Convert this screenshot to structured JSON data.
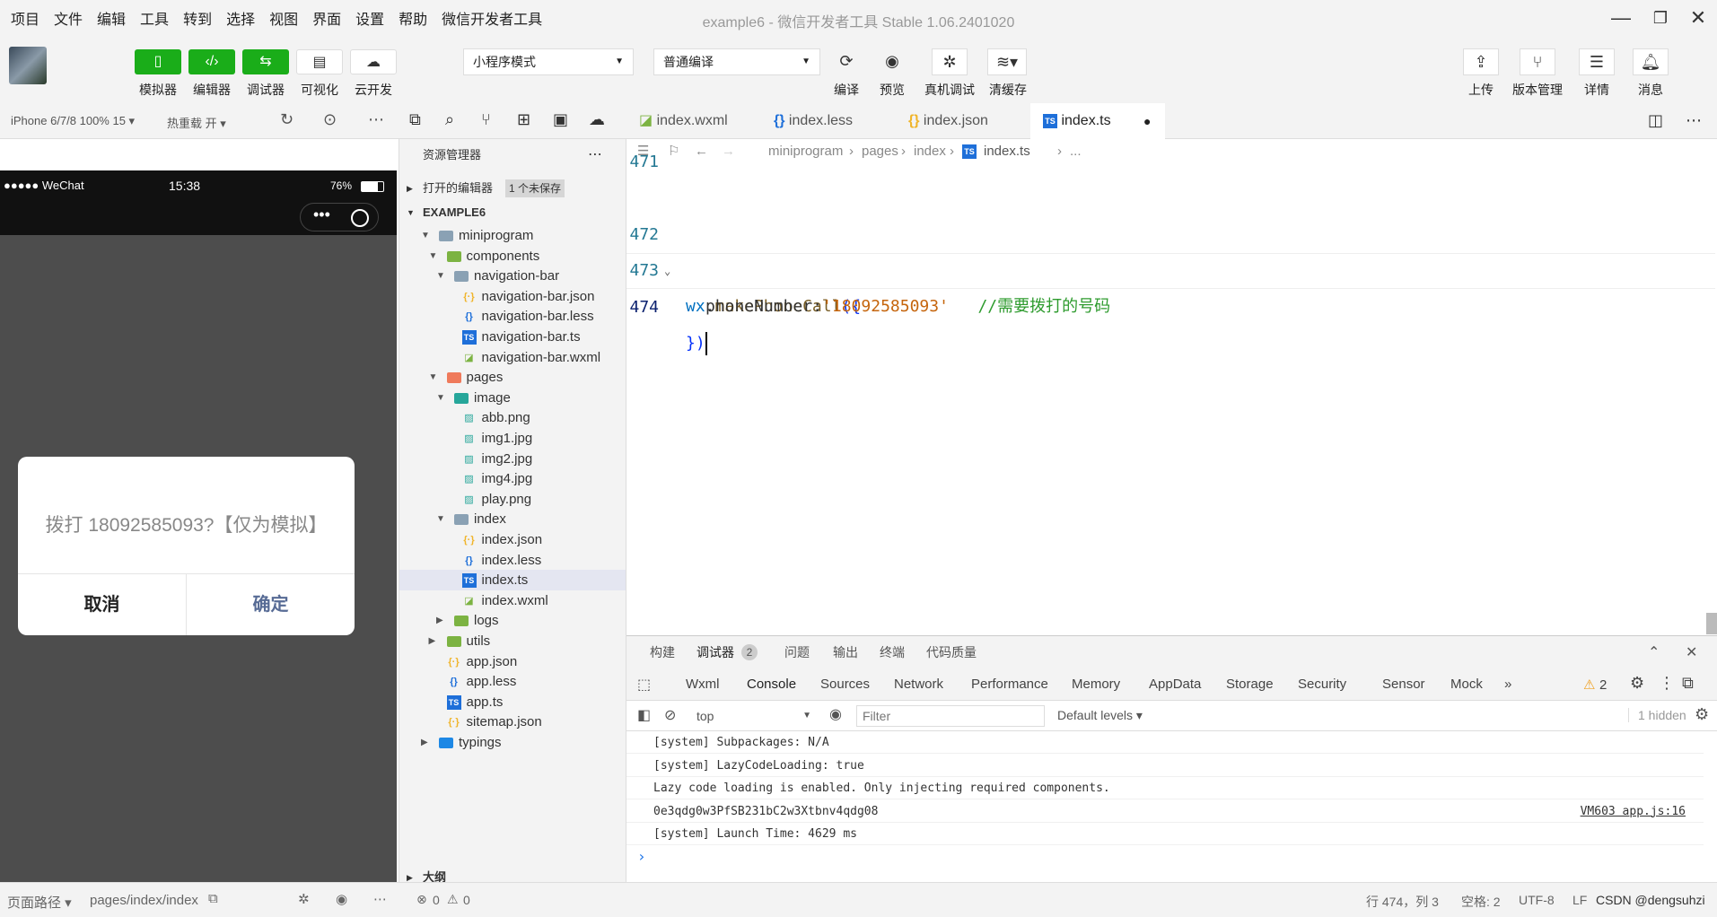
{
  "window": {
    "title": "example6 - 微信开发者工具 Stable 1.06.2401020"
  },
  "menu": [
    "项目",
    "文件",
    "编辑",
    "工具",
    "转到",
    "选择",
    "视图",
    "界面",
    "设置",
    "帮助",
    "微信开发者工具"
  ],
  "toolbar": {
    "left_buttons": [
      {
        "label": "模拟器",
        "icon": "phone-icon"
      },
      {
        "label": "编辑器",
        "icon": "code-icon"
      },
      {
        "label": "调试器",
        "icon": "debug-icon"
      },
      {
        "label": "可视化",
        "icon": "layout-icon"
      },
      {
        "label": "云开发",
        "icon": "cloud-icon"
      }
    ],
    "mode_select": "小程序模式",
    "compile_select": "普通编译",
    "mid_buttons": [
      {
        "label": "编译",
        "icon": "refresh-icon"
      },
      {
        "label": "预览",
        "icon": "eye-icon"
      },
      {
        "label": "真机调试",
        "icon": "bug-icon"
      },
      {
        "label": "清缓存",
        "icon": "layers-icon"
      }
    ],
    "right_buttons": [
      {
        "label": "上传",
        "icon": "upload-icon"
      },
      {
        "label": "版本管理",
        "icon": "branch-icon"
      },
      {
        "label": "详情",
        "icon": "menu-icon"
      },
      {
        "label": "消息",
        "icon": "bell-icon"
      }
    ]
  },
  "simulator": {
    "device": "iPhone 6/7/8 100% 15 ▾",
    "hot_reload": "热重载 开 ▾",
    "status": {
      "carrier": "●●●●● WeChat",
      "time": "15:38",
      "battery": "76%"
    },
    "dialog": {
      "message": "拨打 18092585093?【仅为模拟】",
      "cancel": "取消",
      "confirm": "确定"
    },
    "footer": {
      "path_label": "页面路径 ▾",
      "path": "pages/index/index"
    }
  },
  "explorer": {
    "title": "资源管理器",
    "open_editors": "打开的编辑器",
    "unsaved_badge": "1 个未保存",
    "project": "EXAMPLE6",
    "tree": [
      {
        "label": "miniprogram",
        "type": "folder",
        "indent": 0,
        "open": true
      },
      {
        "label": "components",
        "type": "folder-green",
        "indent": 1,
        "open": true
      },
      {
        "label": "navigation-bar",
        "type": "folder",
        "indent": 2,
        "open": true
      },
      {
        "label": "navigation-bar.json",
        "type": "json",
        "indent": 3
      },
      {
        "label": "navigation-bar.less",
        "type": "less",
        "indent": 3
      },
      {
        "label": "navigation-bar.ts",
        "type": "ts",
        "indent": 3
      },
      {
        "label": "navigation-bar.wxml",
        "type": "wxml",
        "indent": 3
      },
      {
        "label": "pages",
        "type": "folder-red",
        "indent": 1,
        "open": true
      },
      {
        "label": "image",
        "type": "folder-teal",
        "indent": 2,
        "open": true
      },
      {
        "label": "abb.png",
        "type": "img",
        "indent": 3
      },
      {
        "label": "img1.jpg",
        "type": "img",
        "indent": 3
      },
      {
        "label": "img2.jpg",
        "type": "img",
        "indent": 3
      },
      {
        "label": "img4.jpg",
        "type": "img",
        "indent": 3
      },
      {
        "label": "play.png",
        "type": "img",
        "indent": 3
      },
      {
        "label": "index",
        "type": "folder",
        "indent": 2,
        "open": true
      },
      {
        "label": "index.json",
        "type": "json",
        "indent": 3
      },
      {
        "label": "index.less",
        "type": "less",
        "indent": 3
      },
      {
        "label": "index.ts",
        "type": "ts",
        "indent": 3,
        "selected": true
      },
      {
        "label": "index.wxml",
        "type": "wxml",
        "indent": 3
      },
      {
        "label": "logs",
        "type": "folder-green",
        "indent": 2,
        "open": false
      },
      {
        "label": "utils",
        "type": "folder-green",
        "indent": 1,
        "open": false
      },
      {
        "label": "app.json",
        "type": "json",
        "indent": 1
      },
      {
        "label": "app.less",
        "type": "less",
        "indent": 1
      },
      {
        "label": "app.ts",
        "type": "ts",
        "indent": 1
      },
      {
        "label": "sitemap.json",
        "type": "json",
        "indent": 1
      },
      {
        "label": "typings",
        "type": "folder-blue",
        "indent": 0,
        "open": false
      }
    ],
    "outline": "大纲",
    "footer": {
      "errors": "0",
      "warnings": "0"
    }
  },
  "editor": {
    "tabs": [
      {
        "label": "index.wxml",
        "type": "wxml"
      },
      {
        "label": "index.less",
        "type": "less"
      },
      {
        "label": "index.json",
        "type": "json"
      },
      {
        "label": "index.ts",
        "type": "ts",
        "active": true,
        "dirty": "●"
      }
    ],
    "breadcrumb": [
      "miniprogram",
      "pages",
      "index",
      "index.ts",
      "..."
    ],
    "lines": {
      "l471": "471",
      "l472": "472",
      "l473": "473",
      "l474": "474",
      "c472_obj": "wx",
      "c472_dot": ".",
      "c472_fn": "makePhoneCall",
      "c472_open": "({",
      "c473_key": "phoneNumber:",
      "c473_str": "'18092585093'",
      "c473_cmt": "//需要拨打的号码",
      "c474_close": "})"
    }
  },
  "panel": {
    "tabs": [
      "构建",
      "调试器",
      "问题",
      "输出",
      "终端",
      "代码质量"
    ],
    "debugger_badge": "2",
    "devtools_tabs": [
      "Wxml",
      "Console",
      "Sources",
      "Network",
      "Performance",
      "Memory",
      "AppData",
      "Storage",
      "Security",
      "Sensor",
      "Mock",
      "»"
    ],
    "warnings": "2",
    "context": "top",
    "filter_placeholder": "Filter",
    "levels": "Default levels ▾",
    "hidden": "1 hidden",
    "console": [
      {
        "text": "[system] Subpackages: N/A",
        "src": ""
      },
      {
        "text": "[system] LazyCodeLoading: true",
        "src": ""
      },
      {
        "text": "Lazy code loading is enabled. Only injecting required components.",
        "src": ""
      },
      {
        "text": "0e3qdg0w3PfSB231bC2w3Xtbnv4qdg08",
        "src": "VM603 app.js:16"
      },
      {
        "text": "[system] Launch Time: 4629 ms",
        "src": ""
      }
    ],
    "prompt": "›"
  },
  "statusbar": {
    "position": "行 474，列 3",
    "spaces": "空格: 2",
    "encoding": "UTF-8",
    "eol": "LF",
    "watermark": "CSDN @dengsuhzi"
  }
}
